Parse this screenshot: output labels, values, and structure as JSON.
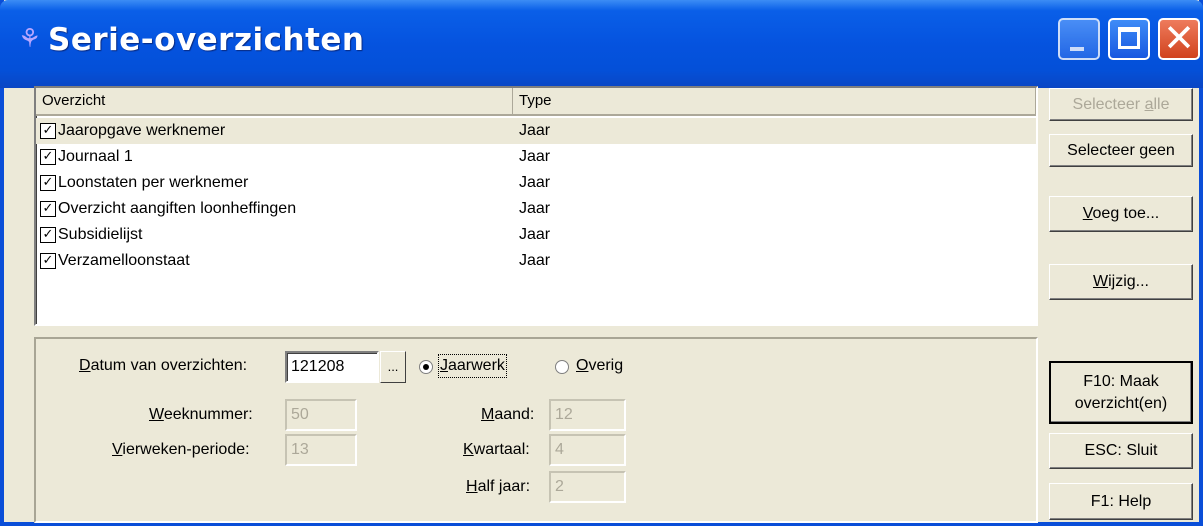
{
  "window": {
    "title": "Serie-overzichten",
    "icon": "app-icon"
  },
  "list": {
    "columns": [
      "Overzicht",
      "Type"
    ],
    "rows": [
      {
        "name": "Jaaropgave werknemer",
        "type": "Jaar",
        "checked": true,
        "selected": true
      },
      {
        "name": "Journaal 1",
        "type": "Jaar",
        "checked": true,
        "selected": false
      },
      {
        "name": "Loonstaten per werknemer",
        "type": "Jaar",
        "checked": true,
        "selected": false
      },
      {
        "name": "Overzicht aangiften loonheffingen",
        "type": "Jaar",
        "checked": true,
        "selected": false
      },
      {
        "name": "Subsidielijst",
        "type": "Jaar",
        "checked": true,
        "selected": false
      },
      {
        "name": "Verzamelloonstaat",
        "type": "Jaar",
        "checked": true,
        "selected": false
      }
    ]
  },
  "form": {
    "date_label_pre": "",
    "date_label_u": "D",
    "date_label_post": "atum van overzichten:",
    "date_value": "121208",
    "browse_label": "...",
    "radio_year_u": "J",
    "radio_year_rest": "aarwerk",
    "radio_other_u": "O",
    "radio_other_rest": "verig",
    "week_u": "W",
    "week_rest": "eeknummer:",
    "week_value": "50",
    "period_u": "V",
    "period_rest": "ierweken-periode:",
    "period_value": "13",
    "month_u": "M",
    "month_rest": "aand:",
    "month_value": "12",
    "quarter_u": "K",
    "quarter_rest": "wartaal:",
    "quarter_value": "4",
    "half_u": "H",
    "half_rest": "alf jaar:",
    "half_value": "2"
  },
  "buttons": {
    "select_all_pre": "Selecteer ",
    "select_all_u": "a",
    "select_all_post": "lle",
    "select_none_pre": "Selecteer ",
    "select_none_u": "g",
    "select_none_post": "een",
    "add_u": "V",
    "add_post": "oeg toe...",
    "edit_u": "W",
    "edit_post": "ijzig...",
    "make_line1": "F10: Maak",
    "make_line2": "overzicht(en)",
    "close": "ESC: Sluit",
    "help": "F1: Help"
  },
  "colors": {
    "titlebar": "#0553df",
    "window_bg": "#ece9d8",
    "close_button": "#d1431e"
  }
}
